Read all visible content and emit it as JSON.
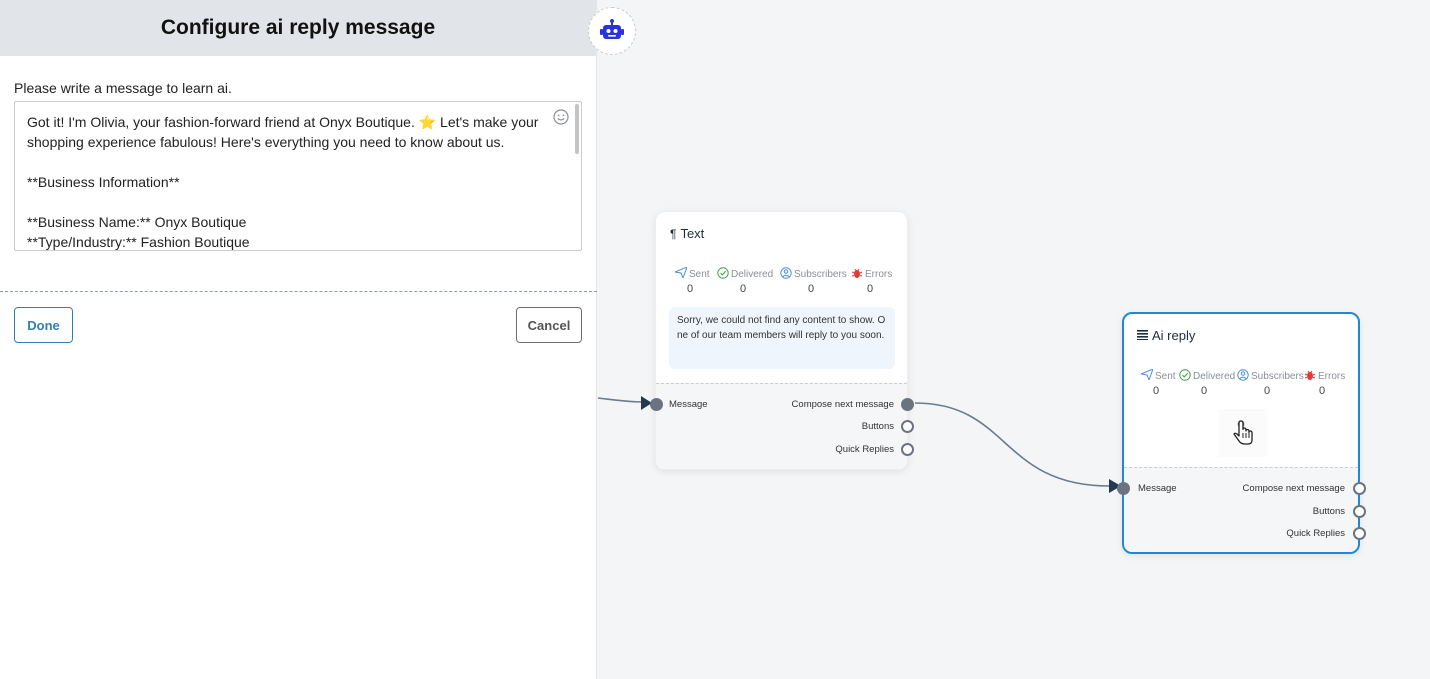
{
  "panel": {
    "title": "Configure ai reply message",
    "prompt_label": "Please write a message to learn ai.",
    "message_text": "Got it! I'm Olivia, your fashion-forward friend at Onyx Boutique. ⭐ Let's make your shopping experience fabulous! Here's everything you need to know about us.\n\n**Business Information**\n\n**Business Name:** Onyx Boutique\n**Type/Industry:** Fashion Boutique",
    "done_label": "Done",
    "cancel_label": "Cancel"
  },
  "canvas": {
    "text_node": {
      "title": "Text",
      "stats": [
        {
          "label": "Sent",
          "value": "0",
          "color": "#4a90d9"
        },
        {
          "label": "Delivered",
          "value": "0",
          "color": "#43a047"
        },
        {
          "label": "Subscribers",
          "value": "0",
          "color": "#4a90d9"
        },
        {
          "label": "Errors",
          "value": "0",
          "color": "#e53935"
        }
      ],
      "message": "Sorry, we could not find any content to show. One of our team members will reply to you soon.",
      "input_port": "Message",
      "output_ports": [
        "Compose next message",
        "Buttons",
        "Quick Replies"
      ]
    },
    "ai_node": {
      "title": "Ai reply",
      "stats": [
        {
          "label": "Sent",
          "value": "0",
          "color": "#4a90d9"
        },
        {
          "label": "Delivered",
          "value": "0",
          "color": "#43a047"
        },
        {
          "label": "Subscribers",
          "value": "0",
          "color": "#4a90d9"
        },
        {
          "label": "Errors",
          "value": "0",
          "color": "#e53935"
        }
      ],
      "input_port": "Message",
      "output_ports": [
        "Compose next message",
        "Buttons",
        "Quick Replies"
      ]
    }
  },
  "colors": {
    "accent": "#1e88d6",
    "edge": "#6c7a8c",
    "bot_icon": "#2b34d9"
  }
}
